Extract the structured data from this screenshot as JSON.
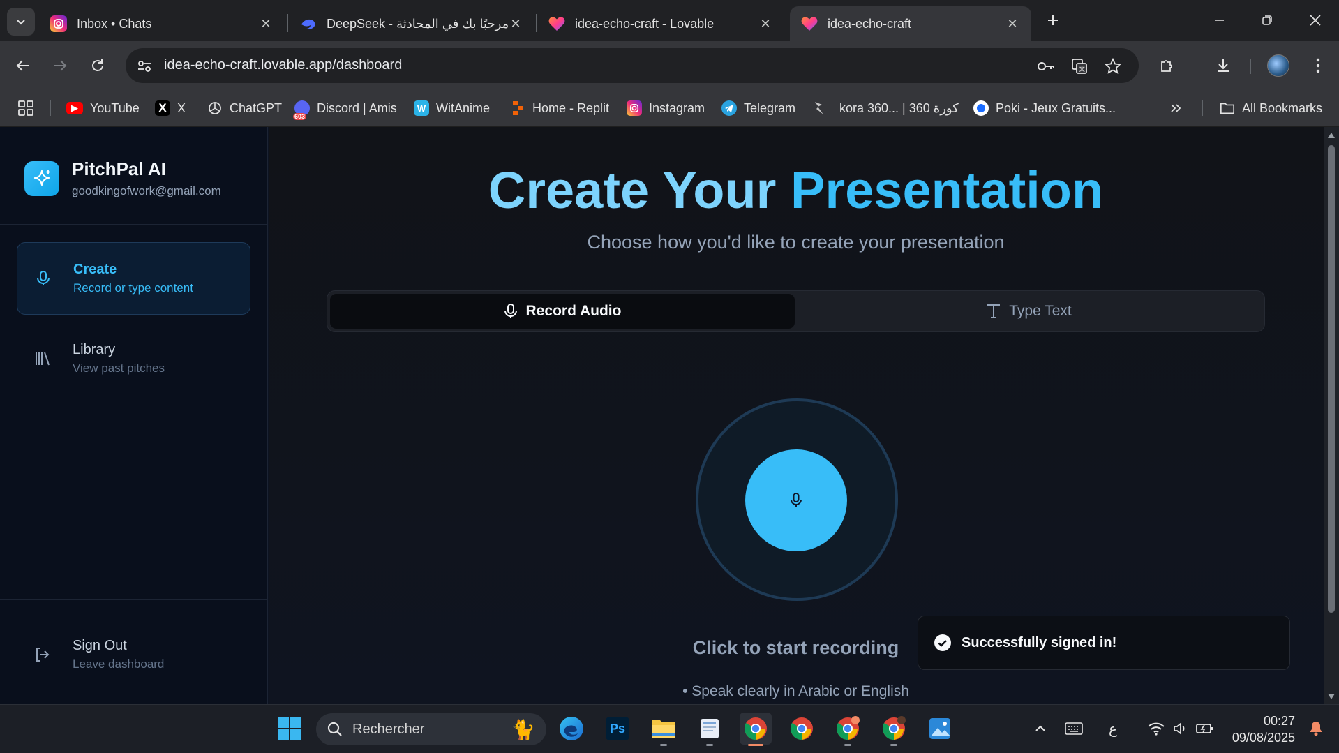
{
  "browser": {
    "tabs": [
      {
        "title": "Inbox • Chats",
        "active": false
      },
      {
        "title": "DeepSeek - مرحبًا بك في المحادثة",
        "active": false
      },
      {
        "title": "idea-echo-craft - Lovable",
        "active": false
      },
      {
        "title": "idea-echo-craft",
        "active": true
      }
    ],
    "url": "idea-echo-craft.lovable.app/dashboard",
    "bookmarks": [
      {
        "label": "YouTube",
        "icon": "youtube-icon"
      },
      {
        "label": "X",
        "icon": "x-icon"
      },
      {
        "label": "ChatGPT",
        "icon": "chatgpt-icon"
      },
      {
        "label": "Discord | Amis",
        "icon": "discord-icon",
        "badge": "603"
      },
      {
        "label": "WitAnime",
        "icon": "witanime-icon"
      },
      {
        "label": "Home - Replit",
        "icon": "replit-icon"
      },
      {
        "label": "Instagram",
        "icon": "instagram-icon"
      },
      {
        "label": "Telegram",
        "icon": "telegram-icon"
      },
      {
        "label": "kora 360... | كورة 360",
        "icon": "kora-icon"
      },
      {
        "label": "Poki - Jeux Gratuits...",
        "icon": "poki-icon"
      }
    ],
    "all_bookmarks": "All Bookmarks"
  },
  "app": {
    "name": "PitchPal AI",
    "email": "goodkingofwork@gmail.com",
    "nav": [
      {
        "title": "Create",
        "subtitle": "Record or type content",
        "active": true
      },
      {
        "title": "Library",
        "subtitle": "View past pitches",
        "active": false
      }
    ],
    "signout": {
      "title": "Sign Out",
      "subtitle": "Leave dashboard"
    }
  },
  "main": {
    "title_part1": "Create Your",
    "title_part2": "Presentation",
    "subtitle": "Choose how you'd like to create your presentation",
    "modes": [
      "Record Audio",
      "Type Text"
    ],
    "active_mode": "Record Audio",
    "record_prompt": "Click to start recording",
    "hint": "• Speak clearly in Arabic or English",
    "toast": "Successfully signed in!"
  },
  "taskbar": {
    "search_placeholder": "Rechercher",
    "language": "ع",
    "time": "00:27",
    "date": "09/08/2025"
  },
  "colors": {
    "accent": "#38bdf8",
    "sidebar_bg": "#090f1c",
    "main_bg": "#111318"
  }
}
